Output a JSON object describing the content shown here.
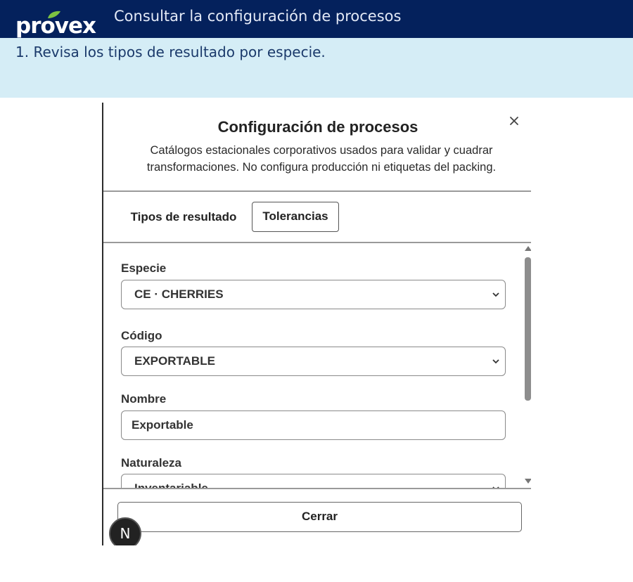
{
  "header": {
    "logo_text": "provex",
    "title": "Consultar la configuración de procesos"
  },
  "step": {
    "text": "1. Revisa los tipos de resultado por especie."
  },
  "modal": {
    "title": "Configuración de procesos",
    "description": "Catálogos estacionales corporativos usados para validar y cuadrar transformaciones. No configura producción ni etiquetas del packing.",
    "close_icon": "close-icon",
    "tabs": [
      {
        "label": "Tipos de resultado",
        "active": false
      },
      {
        "label": "Tolerancias",
        "active": true
      }
    ],
    "fields": {
      "especie": {
        "label": "Especie",
        "value": "CE · CHERRIES"
      },
      "codigo": {
        "label": "Código",
        "value": "EXPORTABLE"
      },
      "nombre": {
        "label": "Nombre",
        "value": "Exportable"
      },
      "naturaleza": {
        "label": "Naturaleza",
        "value": "Inventariable"
      }
    },
    "close_button": "Cerrar",
    "badge": "N"
  },
  "colors": {
    "topbar": "#04215c",
    "banner": "#d5edf6",
    "logo_leaf": "#7cc242"
  }
}
